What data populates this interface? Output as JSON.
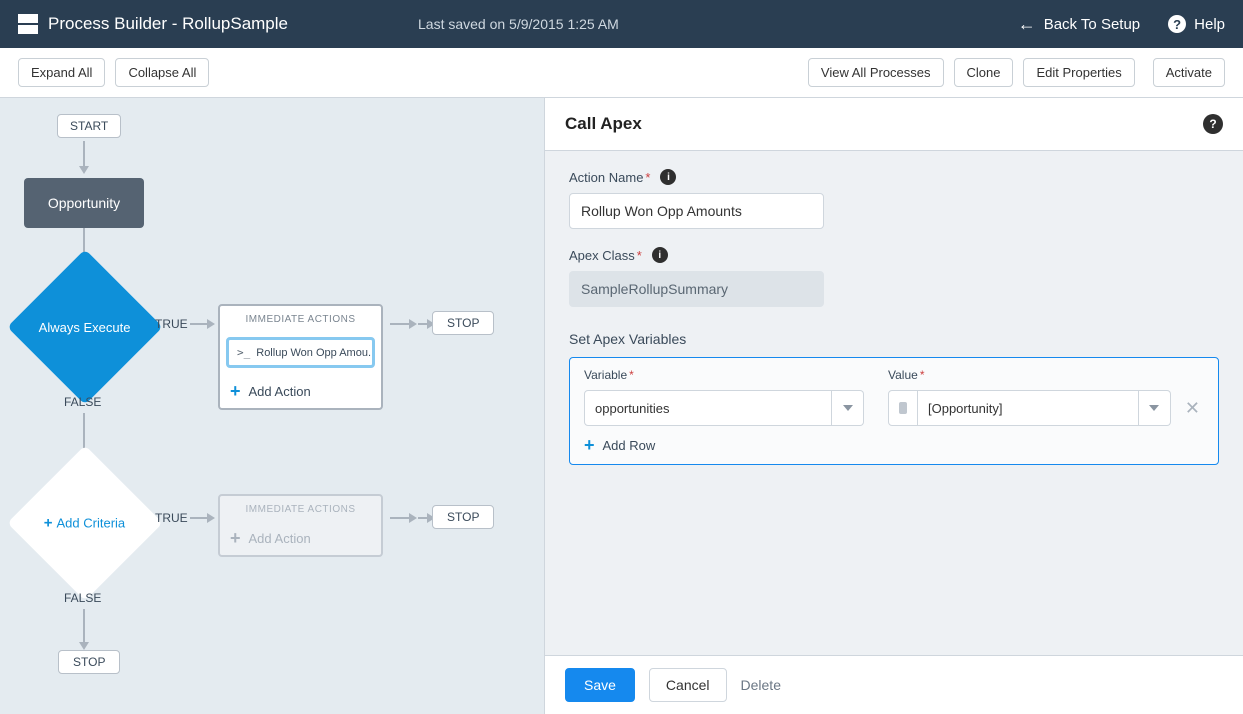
{
  "header": {
    "title": "Process Builder - RollupSample",
    "last_saved": "Last saved on 5/9/2015 1:25 AM",
    "back_label": "Back To Setup",
    "help_label": "Help"
  },
  "toolbar": {
    "expand_all": "Expand All",
    "collapse_all": "Collapse All",
    "view_all": "View All Processes",
    "clone": "Clone",
    "edit_props": "Edit Properties",
    "activate": "Activate"
  },
  "flow": {
    "start": "START",
    "object": "Opportunity",
    "criteria1": "Always Execute",
    "true_label": "TRUE",
    "false_label": "FALSE",
    "immediate_actions": "IMMEDIATE ACTIONS",
    "action_item": "Rollup Won Opp Amou...",
    "add_action": "Add Action",
    "stop": "STOP",
    "add_criteria": "Add Criteria"
  },
  "panel": {
    "title": "Call Apex",
    "action_name_label": "Action Name",
    "action_name_value": "Rollup Won Opp Amounts",
    "apex_class_label": "Apex Class",
    "apex_class_value": "SampleRollupSummary",
    "set_vars_label": "Set Apex Variables",
    "variable_label": "Variable",
    "value_label": "Value",
    "variable_value": "opportunities",
    "value_value": "[Opportunity]",
    "add_row": "Add Row",
    "save": "Save",
    "cancel": "Cancel",
    "delete": "Delete"
  }
}
